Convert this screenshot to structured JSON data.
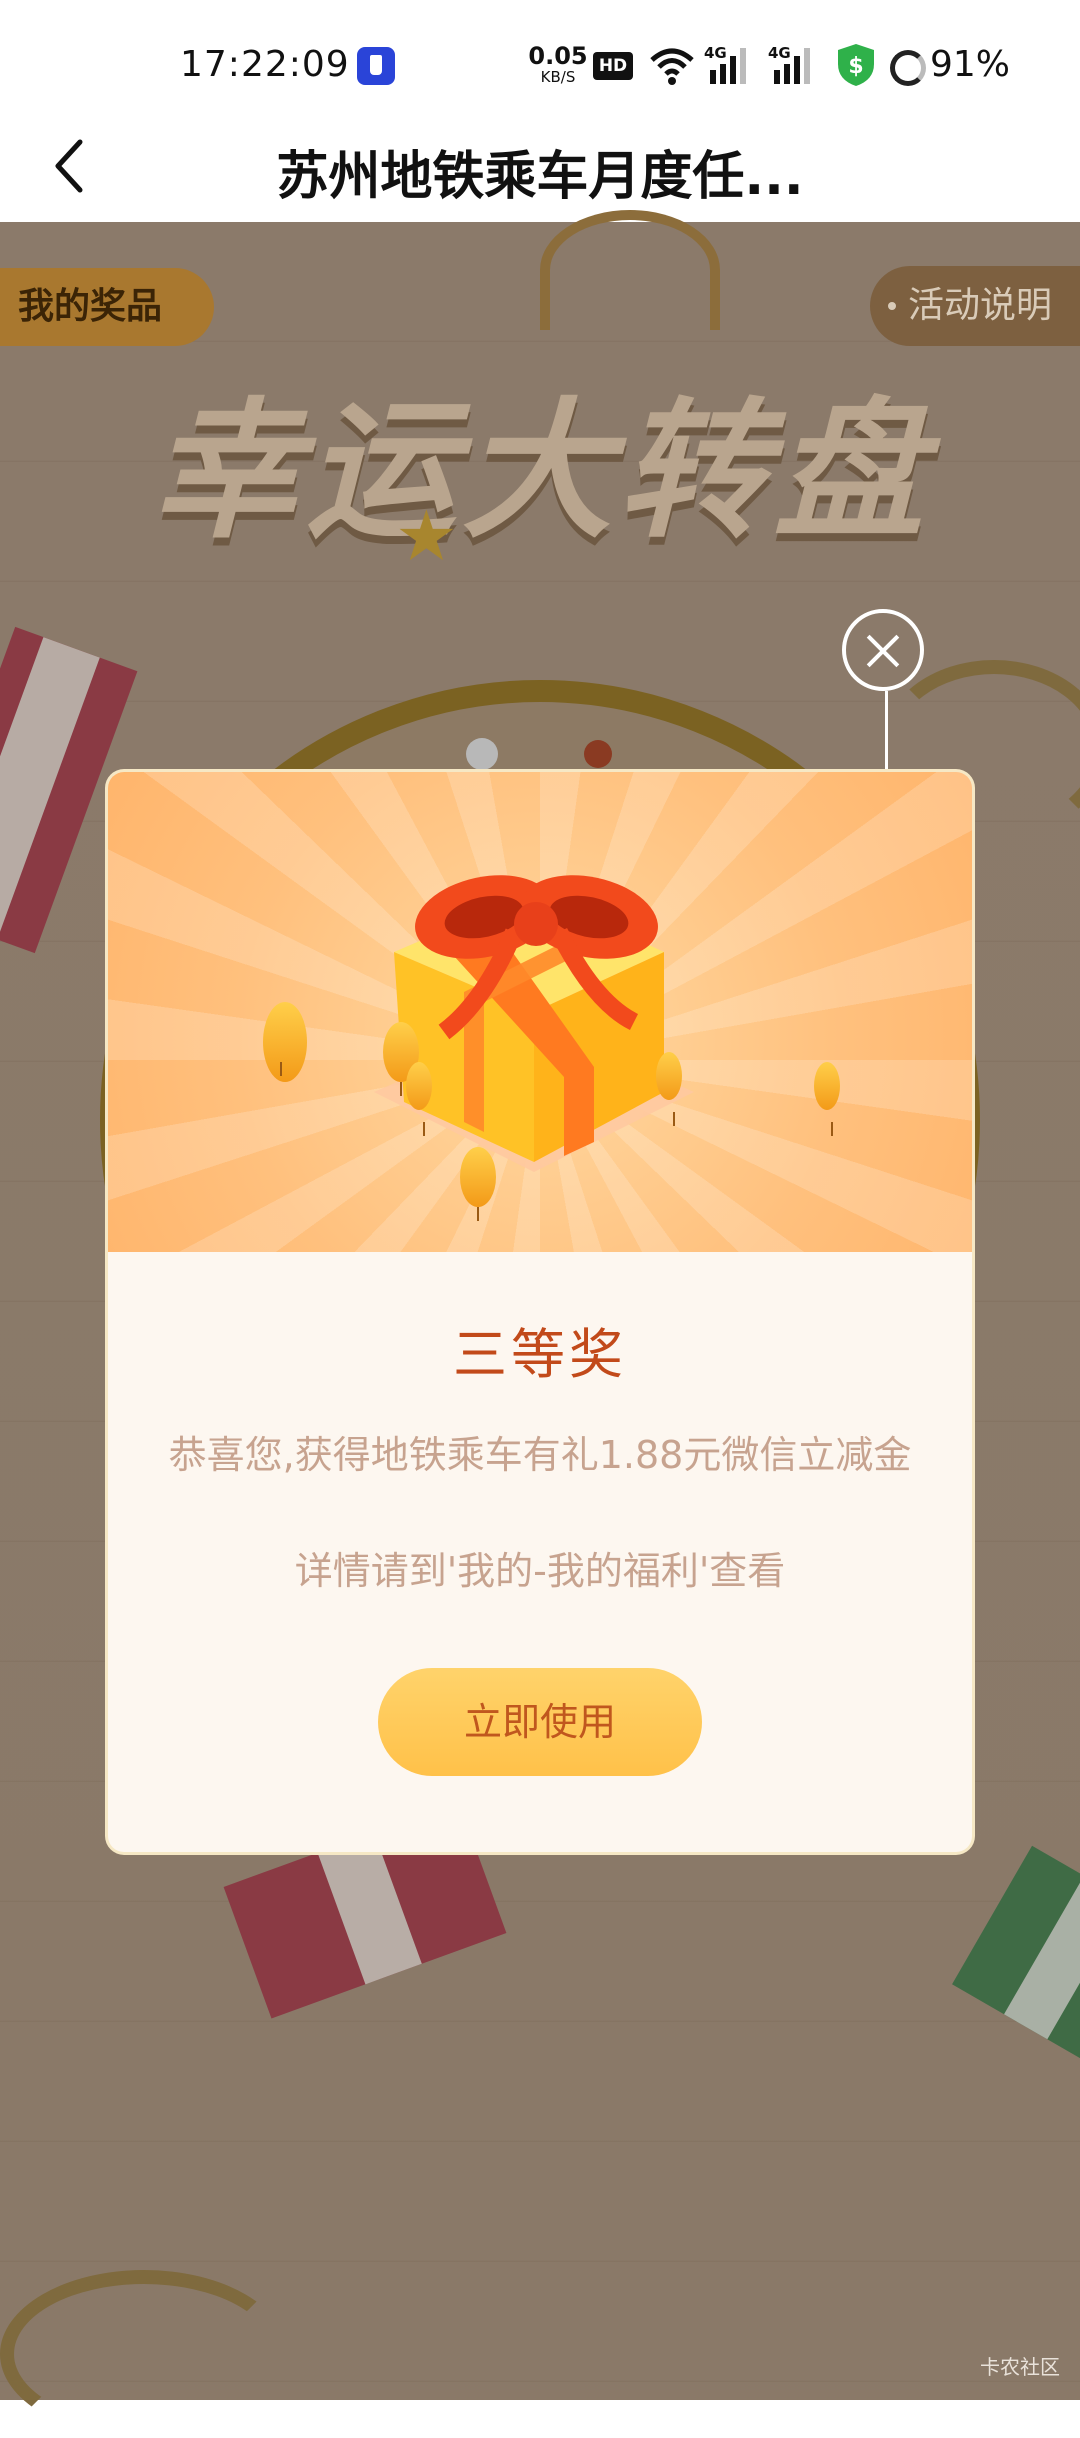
{
  "status_bar": {
    "time": "17:22:09",
    "net_speed_value": "0.05",
    "net_speed_unit": "KB/S",
    "hd_label": "HD",
    "signal_label_1": "4G",
    "signal_label_2": "4G",
    "battery": "91%"
  },
  "nav": {
    "title": "苏州地铁乘车月度任..."
  },
  "page": {
    "my_prizes": "我的奖品",
    "activity_rules": "活动说明",
    "banner_title": "幸运大转盘"
  },
  "dialog": {
    "prize_level": "三等奖",
    "description": "恭喜您,获得地铁乘车有礼1.88元微信立减金",
    "detail": "详情请到'我的-我的福利'查看",
    "button_label": "立即使用"
  },
  "watermark": "卡农社区",
  "colors": {
    "accent_orange": "#c24a1a",
    "button_yellow": "#ffc149",
    "dialog_header": "#ffc07d"
  }
}
